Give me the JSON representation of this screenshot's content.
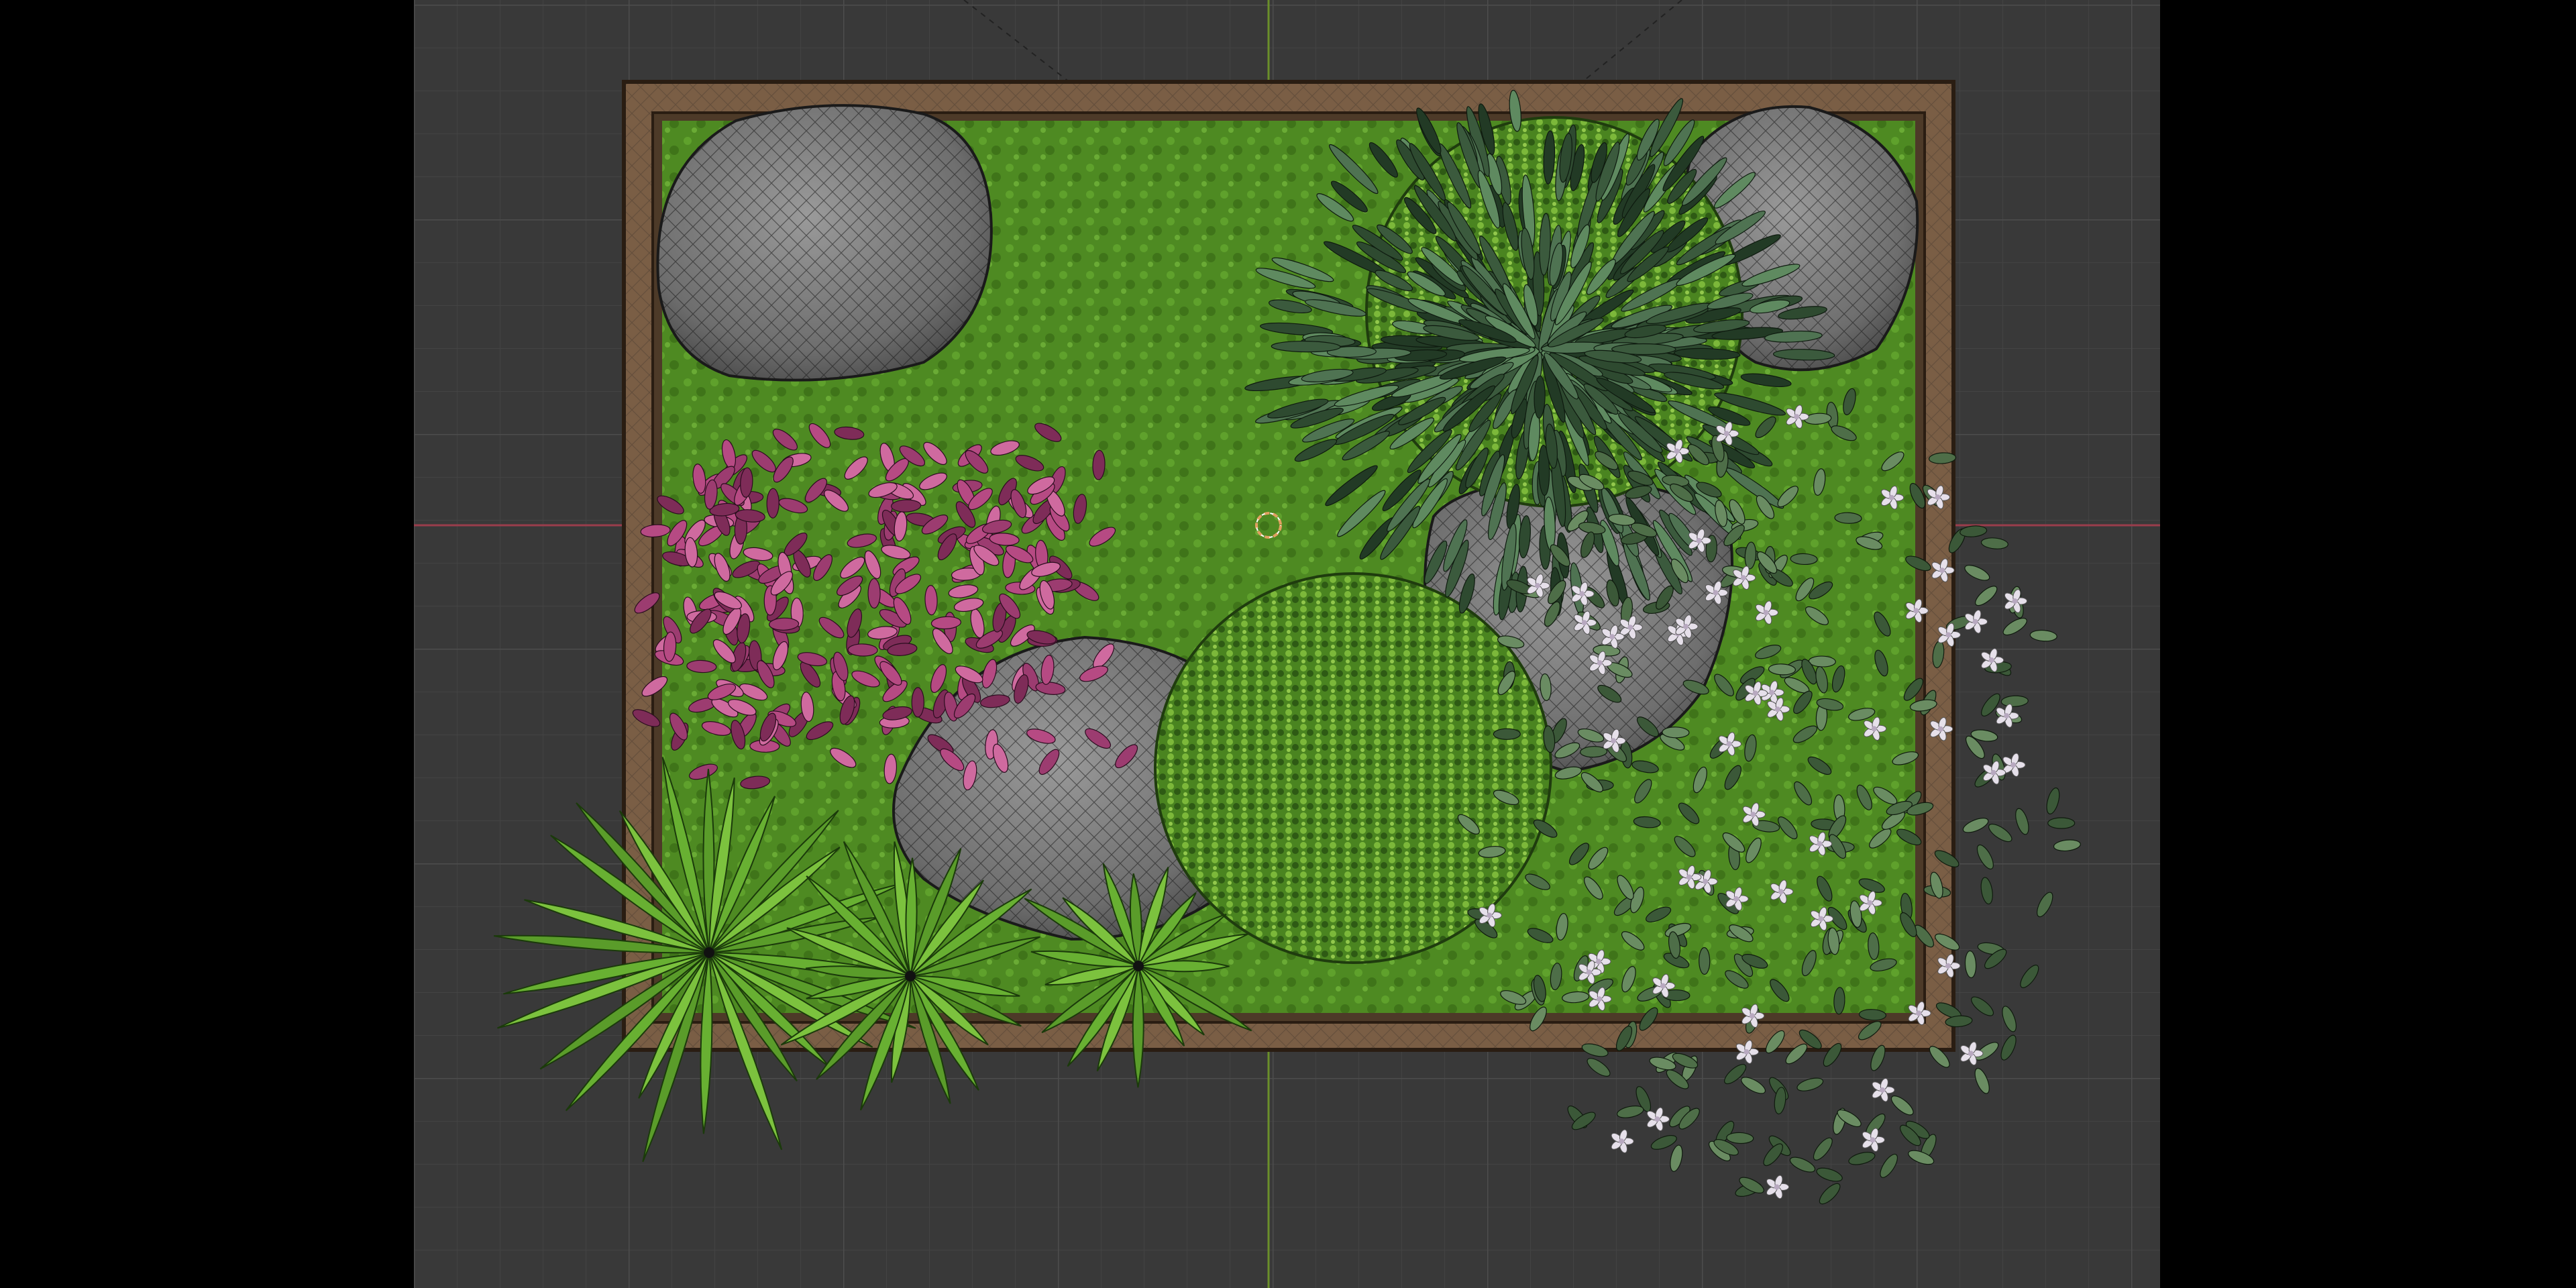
{
  "app": {
    "name": "3D viewport",
    "view": "top-orthographic"
  },
  "colors": {
    "viewport_bg": "#393939",
    "grid_minor": "#434343",
    "grid_major": "#4d4d4d",
    "axis_x": "#9a3d4c",
    "axis_y": "#6b8f2a",
    "frame_wood": "#7a5e45",
    "moss": "#4e8a22",
    "rock": "#7a7a7a",
    "pine": "#3b5a3d",
    "boxwood": "#5d9a2a",
    "pink_plant": "#b64a83",
    "fern": "#68b032",
    "flower_bush": "#4e6e48",
    "flower": "#e6e0ea",
    "cursor": "#e0a060"
  },
  "scene": {
    "objects": [
      {
        "id": "planter-frame",
        "kind": "wooden frame"
      },
      {
        "id": "moss-bed",
        "kind": "moss ground"
      },
      {
        "id": "rock-top-left",
        "kind": "rock"
      },
      {
        "id": "rock-top-right",
        "kind": "rock"
      },
      {
        "id": "rock-center-right",
        "kind": "rock"
      },
      {
        "id": "rock-bottom-left",
        "kind": "rock"
      },
      {
        "id": "pine-bush",
        "kind": "conifer"
      },
      {
        "id": "boxwood-top",
        "kind": "boxwood"
      },
      {
        "id": "boxwood-bottom",
        "kind": "boxwood"
      },
      {
        "id": "pink-plant",
        "kind": "foliage"
      },
      {
        "id": "fern-large",
        "kind": "fern"
      },
      {
        "id": "fern-medium",
        "kind": "fern"
      },
      {
        "id": "fern-small",
        "kind": "fern"
      },
      {
        "id": "flowering-bush",
        "kind": "flowering shrub"
      }
    ],
    "cursor": "3d-cursor-icon"
  }
}
